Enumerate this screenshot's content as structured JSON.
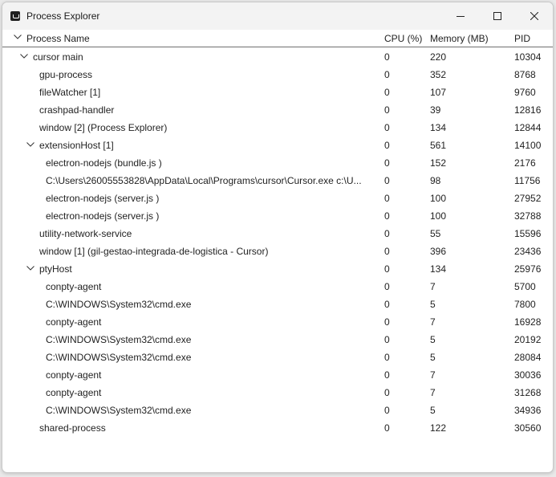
{
  "window": {
    "title": "Process Explorer"
  },
  "columns": {
    "name": "Process Name",
    "cpu": "CPU (%)",
    "memory": "Memory (MB)",
    "pid": "PID"
  },
  "processes": [
    {
      "name": "cursor main",
      "cpu": "0",
      "memory": "220",
      "pid": "10304",
      "level": 0,
      "expandable": true
    },
    {
      "name": "gpu-process",
      "cpu": "0",
      "memory": "352",
      "pid": "8768",
      "level": 1,
      "expandable": false
    },
    {
      "name": "fileWatcher [1]",
      "cpu": "0",
      "memory": "107",
      "pid": "9760",
      "level": 1,
      "expandable": false
    },
    {
      "name": "crashpad-handler",
      "cpu": "0",
      "memory": "39",
      "pid": "12816",
      "level": 1,
      "expandable": false
    },
    {
      "name": "window [2] (Process Explorer)",
      "cpu": "0",
      "memory": "134",
      "pid": "12844",
      "level": 1,
      "expandable": false
    },
    {
      "name": "extensionHost [1]",
      "cpu": "0",
      "memory": "561",
      "pid": "14100",
      "level": 1,
      "expandable": true
    },
    {
      "name": "electron-nodejs (bundle.js )",
      "cpu": "0",
      "memory": "152",
      "pid": "2176",
      "level": 2,
      "expandable": false
    },
    {
      "name": "C:\\Users\\26005553828\\AppData\\Local\\Programs\\cursor\\Cursor.exe c:\\U...",
      "cpu": "0",
      "memory": "98",
      "pid": "11756",
      "level": 2,
      "expandable": false
    },
    {
      "name": "electron-nodejs (server.js )",
      "cpu": "0",
      "memory": "100",
      "pid": "27952",
      "level": 2,
      "expandable": false
    },
    {
      "name": "electron-nodejs (server.js )",
      "cpu": "0",
      "memory": "100",
      "pid": "32788",
      "level": 2,
      "expandable": false
    },
    {
      "name": "utility-network-service",
      "cpu": "0",
      "memory": "55",
      "pid": "15596",
      "level": 1,
      "expandable": false
    },
    {
      "name": "window [1] (gil-gestao-integrada-de-logistica - Cursor)",
      "cpu": "0",
      "memory": "396",
      "pid": "23436",
      "level": 1,
      "expandable": false
    },
    {
      "name": "ptyHost",
      "cpu": "0",
      "memory": "134",
      "pid": "25976",
      "level": 1,
      "expandable": true
    },
    {
      "name": "conpty-agent",
      "cpu": "0",
      "memory": "7",
      "pid": "5700",
      "level": 2,
      "expandable": false
    },
    {
      "name": "C:\\WINDOWS\\System32\\cmd.exe",
      "cpu": "0",
      "memory": "5",
      "pid": "7800",
      "level": 2,
      "expandable": false
    },
    {
      "name": "conpty-agent",
      "cpu": "0",
      "memory": "7",
      "pid": "16928",
      "level": 2,
      "expandable": false
    },
    {
      "name": "C:\\WINDOWS\\System32\\cmd.exe",
      "cpu": "0",
      "memory": "5",
      "pid": "20192",
      "level": 2,
      "expandable": false
    },
    {
      "name": "C:\\WINDOWS\\System32\\cmd.exe",
      "cpu": "0",
      "memory": "5",
      "pid": "28084",
      "level": 2,
      "expandable": false
    },
    {
      "name": "conpty-agent",
      "cpu": "0",
      "memory": "7",
      "pid": "30036",
      "level": 2,
      "expandable": false
    },
    {
      "name": "conpty-agent",
      "cpu": "0",
      "memory": "7",
      "pid": "31268",
      "level": 2,
      "expandable": false
    },
    {
      "name": "C:\\WINDOWS\\System32\\cmd.exe",
      "cpu": "0",
      "memory": "5",
      "pid": "34936",
      "level": 2,
      "expandable": false
    },
    {
      "name": "shared-process",
      "cpu": "0",
      "memory": "122",
      "pid": "30560",
      "level": 1,
      "expandable": false
    }
  ]
}
